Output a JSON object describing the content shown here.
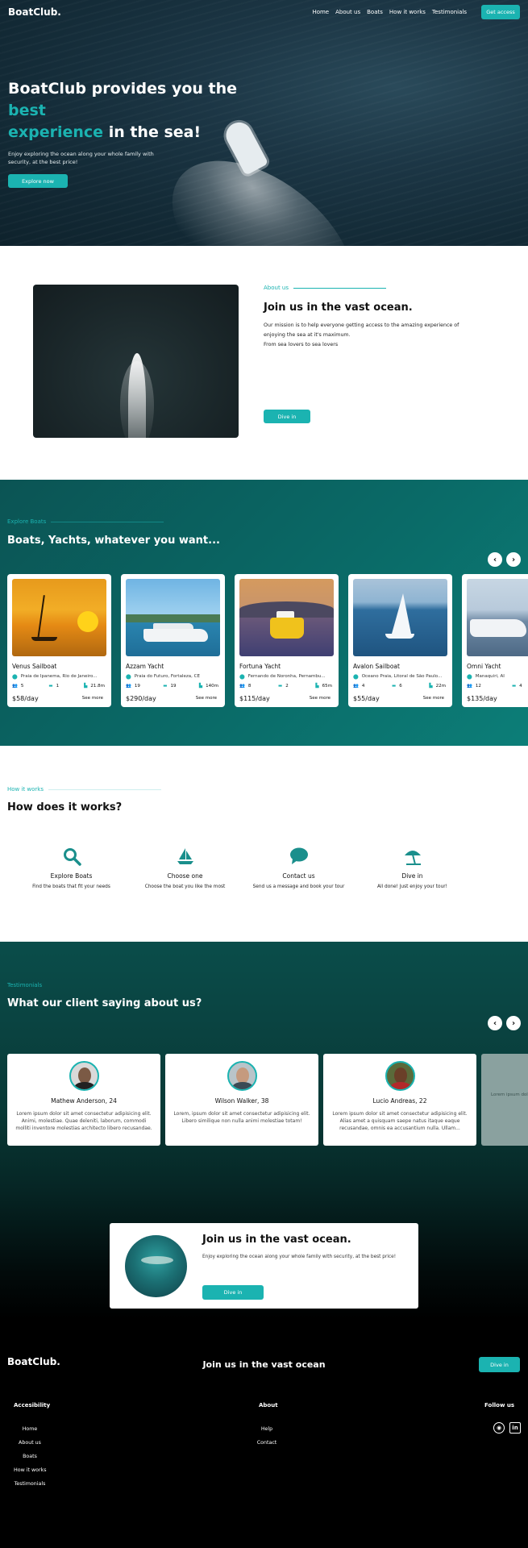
{
  "brand": "BoatClub.",
  "nav": {
    "links": [
      "Home",
      "About us",
      "Boats",
      "How it works",
      "Testimonials"
    ],
    "cta": "Get access"
  },
  "hero": {
    "title_part1": "BoatClub provides you the ",
    "title_accent1": "best",
    "title_accent2": "experience",
    "title_part2": " in the sea!",
    "subtitle": "Enjoy exploring the ocean along your whole family with security, at the best price!",
    "button": "Explore now"
  },
  "about": {
    "tag": "About us",
    "title": "Join us in the vast ocean.",
    "body_line1": "Our mission is to help everyone getting access to the amazing experience of enjoying the sea at it's maximum.",
    "body_line2": "From sea lovers to sea lovers",
    "button": "Dive in"
  },
  "boats": {
    "tag": "Explore Boats",
    "title": "Boats, Yachts, whatever you want...",
    "see_more": "See more",
    "items": [
      {
        "name": "Venus Sailboat",
        "location": "Praia de Ipanema, Rio de Janeiro...",
        "guests": "5",
        "beds": "1",
        "size": "21.8m",
        "price": "$58/day"
      },
      {
        "name": "Azzam Yacht",
        "location": "Praia do Futuro, Fortaleza, CE",
        "guests": "19",
        "beds": "19",
        "size": "140m",
        "price": "$290/day"
      },
      {
        "name": "Fortuna Yacht",
        "location": "Fernando de Noronha, Pernambu...",
        "guests": "8",
        "beds": "2",
        "size": "65m",
        "price": "$115/day"
      },
      {
        "name": "Avalon Sailboat",
        "location": "Oceano Praia, Litoral de São Paulo...",
        "guests": "4",
        "beds": "6",
        "size": "22m",
        "price": "$55/day"
      },
      {
        "name": "Omni Yacht",
        "location": "Manaquiri, AI",
        "guests": "12",
        "beds": "4",
        "size": "",
        "price": "$135/day"
      }
    ]
  },
  "how": {
    "tag": "How it works",
    "title": "How does it works?",
    "steps": [
      {
        "icon": "search-icon",
        "title": "Explore Boats",
        "desc": "Find the boats that fit your needs"
      },
      {
        "icon": "sailboat-icon",
        "title": "Choose one",
        "desc": "Choose the boat you like the most"
      },
      {
        "icon": "chat-icon",
        "title": "Contact us",
        "desc": "Send us a message and book your tour"
      },
      {
        "icon": "beach-umbrella-icon",
        "title": "Dive in",
        "desc": "All done! Just enjoy your tour!"
      }
    ]
  },
  "testimonials": {
    "tag": "Testimonials",
    "title": "What our client saying about us?",
    "items": [
      {
        "name": "Mathew Anderson, 24",
        "text": "Lorem ipsum dolor sit amet consectetur adipisicing elit. Animi, molestiae. Quae deleniti, laborum, commodi molliti inventore molestias architecto libero recusandae."
      },
      {
        "name": "Wilson Walker, 38",
        "text": "Lorem, ipsum dolor sit amet consectetur adipisicing elit. Libero similique non nulla animi molestiae totam!"
      },
      {
        "name": "Lucio Andreas, 22",
        "text": "Lorem ipsum dolor sit amet consectetur adipisicing elit. Alias amet a quisquam saepe natus itaque eaque recusandae, omnis ea accusantium nulla. Ullam..."
      }
    ],
    "partial_text": "Lorem ipsum dolor sit amet consectetur adipisicing elit. Natus quisquam"
  },
  "cta": {
    "title": "Join us in the vast ocean.",
    "subtitle": "Enjoy exploring the ocean along your whole family with security, at the best price!",
    "button": "Dive in"
  },
  "footer": {
    "cta": "Join us in the vast ocean",
    "button": "Dive in",
    "col1_title": "Accesibility",
    "col1_links": [
      "Home",
      "About us",
      "Boats",
      "How it works",
      "Testimonials"
    ],
    "col2_title": "About",
    "col2_links": [
      "Help",
      "Contact"
    ],
    "col3_title": "Follow us"
  },
  "colors": {
    "accent": "#1bb3b1",
    "teal_bg": "#0a6a67",
    "footer_bg": "#000000"
  }
}
